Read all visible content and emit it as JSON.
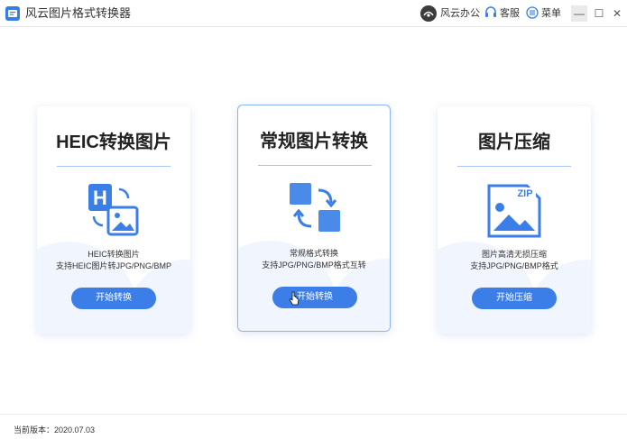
{
  "app": {
    "title": "风云图片格式转换器",
    "brand_label": "风云办公",
    "service_label": "客服",
    "menu_label": "菜单",
    "minimize_glyph": "—",
    "maximize_glyph": "☐",
    "close_glyph": "✕"
  },
  "cards": [
    {
      "title": "HEIC转换图片",
      "desc_line1": "HEIC转换图片",
      "desc_line2": "支持HEIC图片转JPG/PNG/BMP",
      "button_label": "开始转换",
      "icon": "heic-to-image-icon",
      "icon_letter": "H"
    },
    {
      "title": "常规图片转换",
      "desc_line1": "常规格式转换",
      "desc_line2": "支持JPG/PNG/BMP格式互转",
      "button_label": "开始转换",
      "icon": "convert-arrows-icon"
    },
    {
      "title": "图片压缩",
      "desc_line1": "图片高清无损压缩",
      "desc_line2": "支持JPG/PNG/BMP格式",
      "button_label": "开始压缩",
      "icon": "zip-image-icon",
      "icon_badge": "ZIP"
    }
  ],
  "footer": {
    "version": "当前版本：2020.07.03"
  },
  "colors": {
    "accent": "#3b7ee8",
    "divider": "#a9c6ef",
    "active_border": "#8cb3ef"
  }
}
